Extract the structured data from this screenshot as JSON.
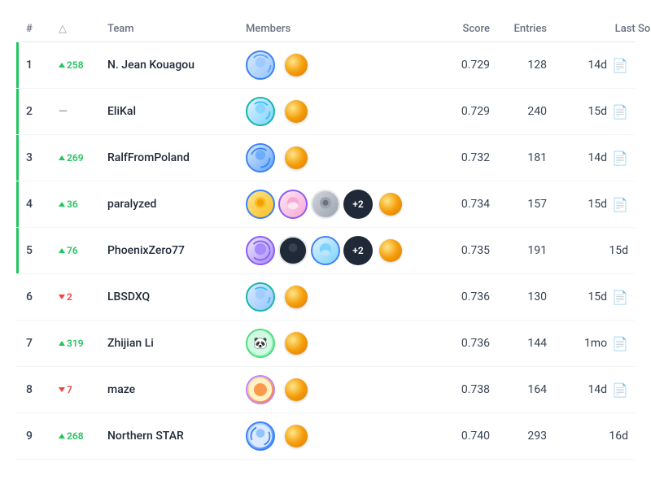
{
  "header": {
    "col_rank": "#",
    "col_change": "△",
    "col_team": "Team",
    "col_members": "Members",
    "col_score": "Score",
    "col_entries": "Entries",
    "col_last": "Last Solution"
  },
  "rows": [
    {
      "rank": "1",
      "change_type": "up",
      "change_val": "258",
      "team": "N. Jean Kouagou",
      "score": "0.729",
      "entries": "128",
      "last": "14d",
      "has_solution": true,
      "members_count": 1,
      "medal_border": "gold"
    },
    {
      "rank": "2",
      "change_type": "neutral",
      "change_val": "—",
      "team": "EliKal",
      "score": "0.729",
      "entries": "240",
      "last": "15d",
      "has_solution": true,
      "members_count": 1,
      "medal_border": "silver"
    },
    {
      "rank": "3",
      "change_type": "up",
      "change_val": "269",
      "team": "RalfFromPoland",
      "score": "0.732",
      "entries": "181",
      "last": "14d",
      "has_solution": true,
      "members_count": 1,
      "medal_border": "bronze"
    },
    {
      "rank": "4",
      "change_type": "up",
      "change_val": "36",
      "team": "paralyzed",
      "score": "0.734",
      "entries": "157",
      "last": "15d",
      "has_solution": true,
      "members_count": 3,
      "extra": "+2",
      "medal_border": "rank4"
    },
    {
      "rank": "5",
      "change_type": "up",
      "change_val": "76",
      "team": "PhoenixZero77",
      "score": "0.735",
      "entries": "191",
      "last": "15d",
      "has_solution": false,
      "members_count": 3,
      "extra": "+2",
      "medal_border": "rank5"
    },
    {
      "rank": "6",
      "change_type": "down",
      "change_val": "2",
      "team": "LBSDXQ",
      "score": "0.736",
      "entries": "130",
      "last": "15d",
      "has_solution": true,
      "members_count": 1,
      "medal_border": "none"
    },
    {
      "rank": "7",
      "change_type": "up",
      "change_val": "319",
      "team": "Zhijian Li",
      "score": "0.736",
      "entries": "144",
      "last": "1mo",
      "has_solution": true,
      "members_count": 1,
      "medal_border": "none"
    },
    {
      "rank": "8",
      "change_type": "down",
      "change_val": "7",
      "team": "maze",
      "score": "0.738",
      "entries": "164",
      "last": "14d",
      "has_solution": true,
      "members_count": 1,
      "medal_border": "none"
    },
    {
      "rank": "9",
      "change_type": "up",
      "change_val": "268",
      "team": "Northern STAR",
      "score": "0.740",
      "entries": "293",
      "last": "16d",
      "has_solution": false,
      "members_count": 1,
      "medal_border": "none"
    }
  ]
}
